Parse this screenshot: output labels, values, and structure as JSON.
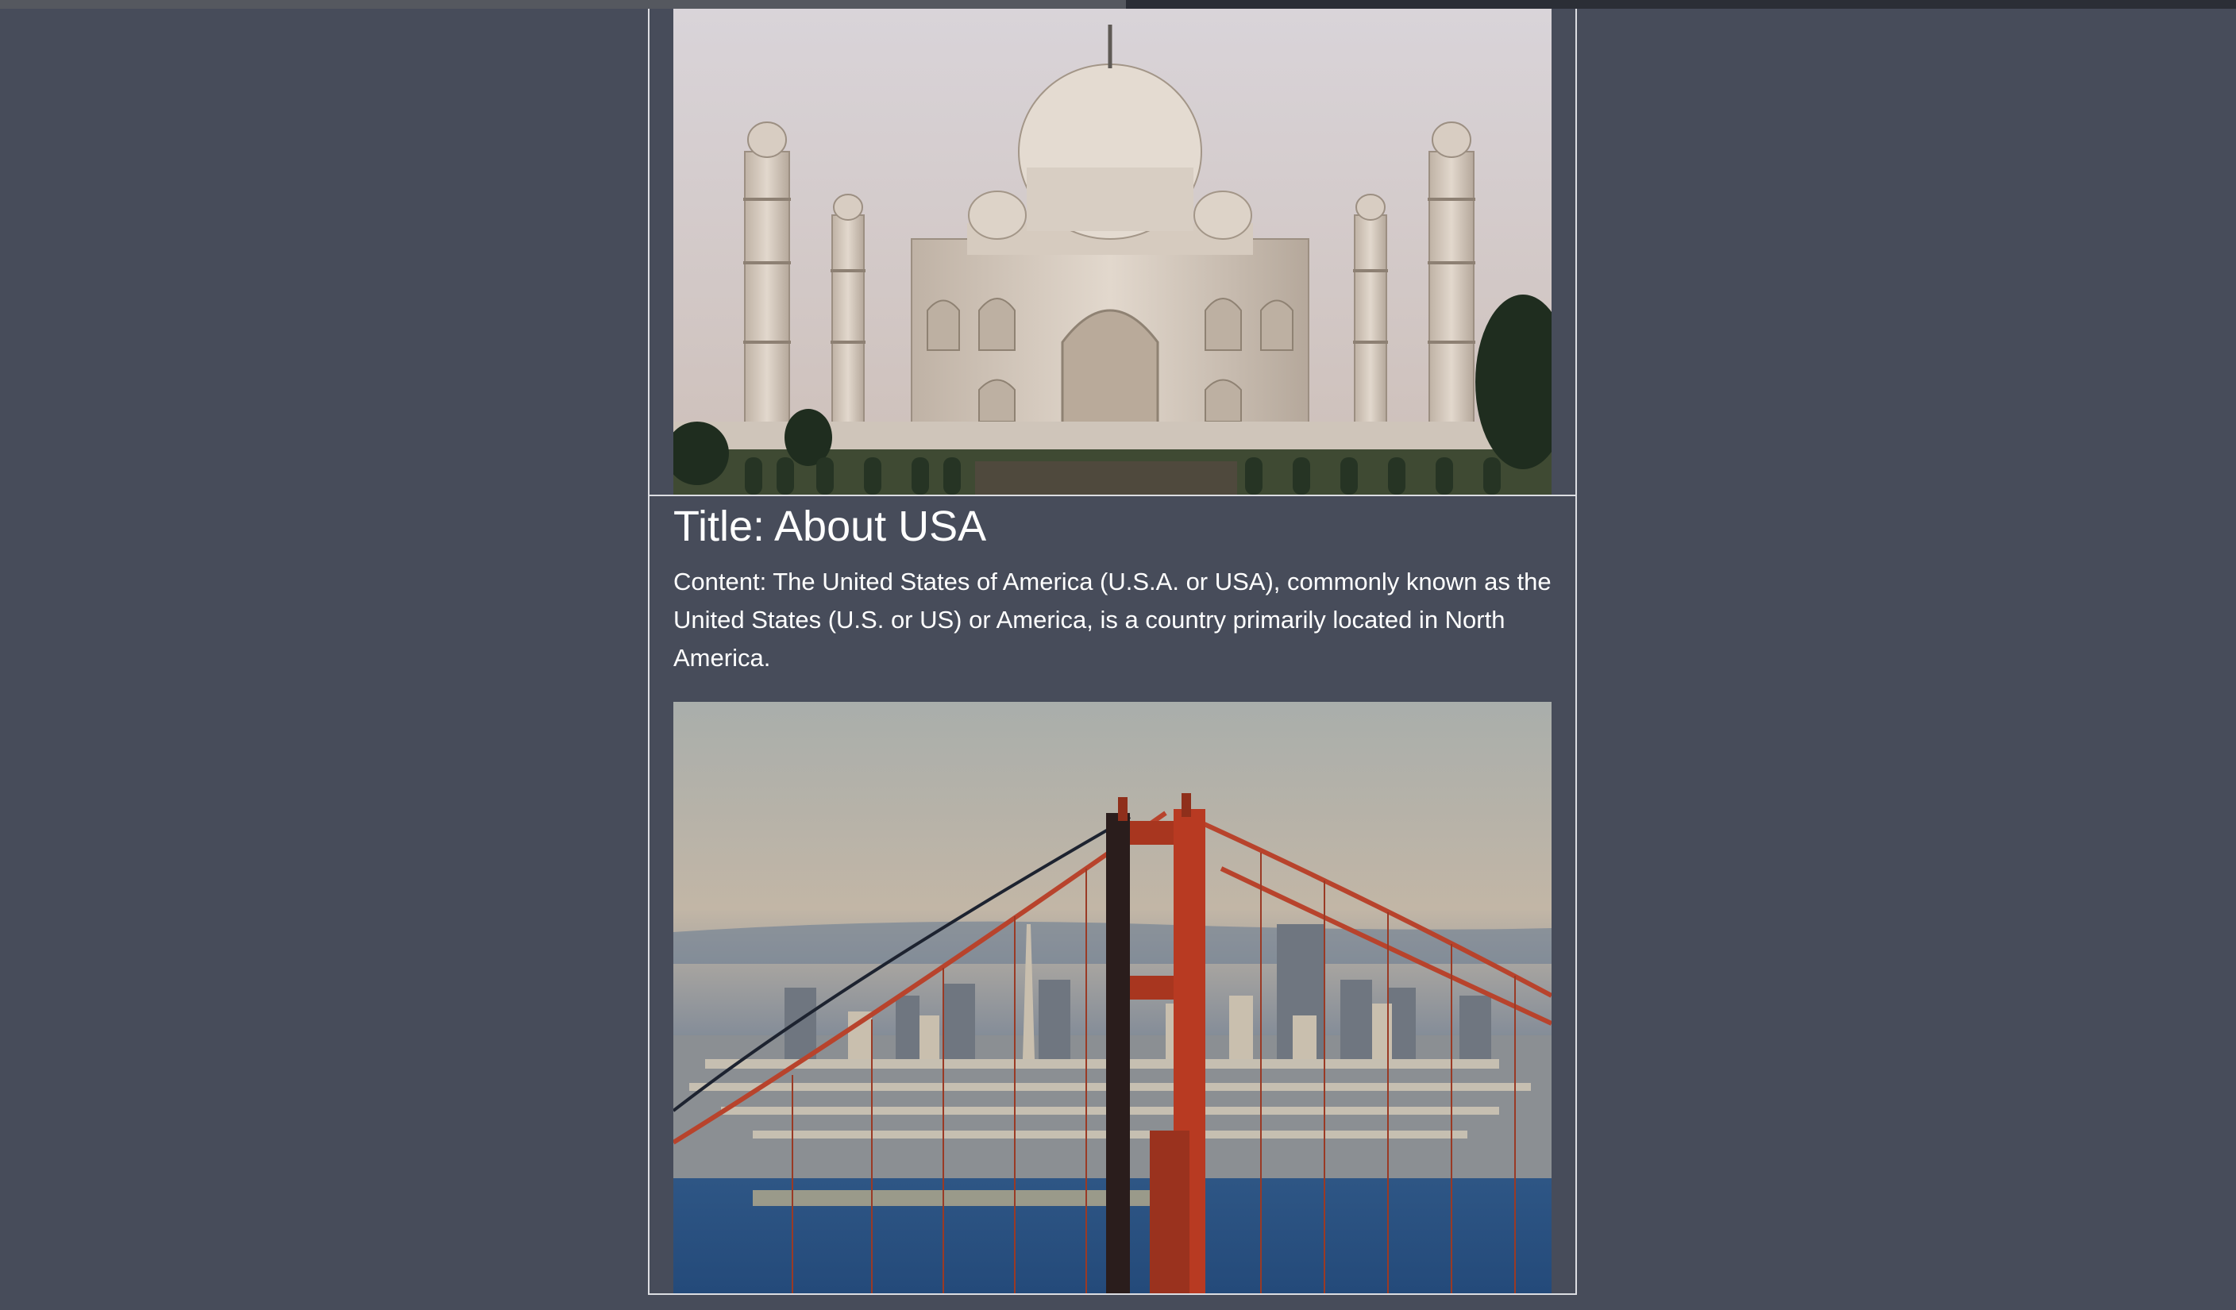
{
  "cards": [
    {
      "image": {
        "subject": "Taj Mahal",
        "sky_color": "#d8d0d2"
      }
    },
    {
      "title": "Title: About USA",
      "content": "Content: The United States of America (U.S.A. or USA), commonly known as the United States (U.S. or US) or America, is a country primarily located in North America.",
      "image": {
        "subject": "Golden Gate Bridge with San Francisco skyline",
        "bridge_color": "#b83a22"
      }
    }
  ],
  "theme": {
    "background": "#474c5a",
    "border": "#dcdde2",
    "text": "#ffffff"
  }
}
